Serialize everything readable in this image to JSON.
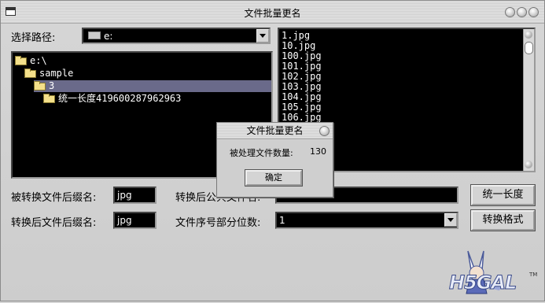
{
  "window": {
    "title": "文件批量更名"
  },
  "path_label": "选择路径:",
  "drive": {
    "value": "e:"
  },
  "tree": [
    {
      "label": "e:\\",
      "indent": 0,
      "selected": false
    },
    {
      "label": "sample",
      "indent": 1,
      "selected": false
    },
    {
      "label": "3",
      "indent": 2,
      "selected": true
    },
    {
      "label": "统一长度419600287962963",
      "indent": 3,
      "selected": false
    }
  ],
  "files": [
    "1.jpg",
    "10.jpg",
    "100.jpg",
    "101.jpg",
    "102.jpg",
    "103.jpg",
    "104.jpg",
    "105.jpg",
    "106.jpg"
  ],
  "form": {
    "source_ext_label": "被转换文件后缀名:",
    "source_ext_value": "jpg",
    "target_ext_label": "转换后文件后缀名:",
    "target_ext_value": "jpg",
    "common_name_label": "转换后公共文件名:",
    "common_name_value": "",
    "digits_label": "文件序号部分位数:",
    "digits_value": "1",
    "unify_button": "统一长度",
    "convert_button": "转换格式"
  },
  "dialog": {
    "title": "文件批量更名",
    "message": "被处理文件数量:",
    "count": "130",
    "ok_button": "确定"
  },
  "logo": {
    "text": "H5GAL",
    "tm": "TM"
  }
}
